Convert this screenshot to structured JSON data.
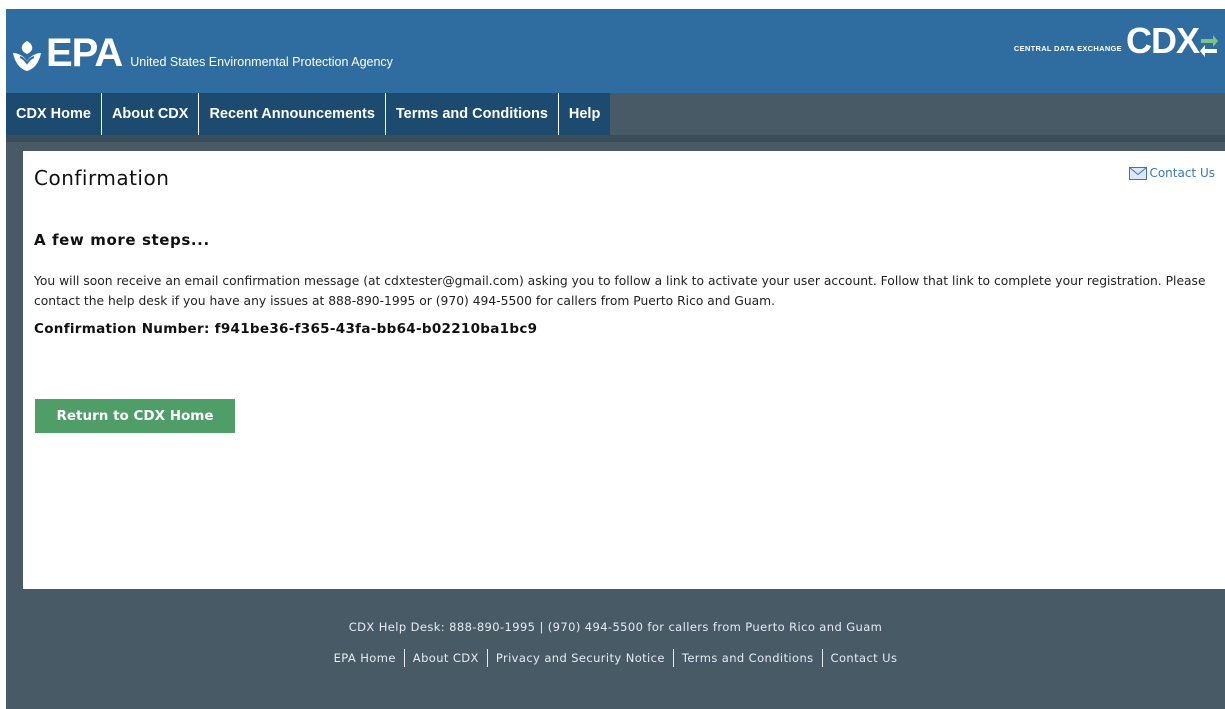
{
  "header": {
    "logo_text": "EPA",
    "agency_name": "United States Environmental Protection Agency",
    "cdx_subtitle": "CENTRAL DATA EXCHANGE",
    "cdx_logo_text": "CDX"
  },
  "nav": {
    "items": [
      {
        "label": "CDX Home"
      },
      {
        "label": "About CDX"
      },
      {
        "label": "Recent Announcements"
      },
      {
        "label": "Terms and Conditions"
      },
      {
        "label": "Help"
      }
    ]
  },
  "main": {
    "title": "Confirmation",
    "contact_label": "Contact Us",
    "subheading": "A few more steps...",
    "message": "You will soon receive an email confirmation message (at cdxtester@gmail.com) asking you to follow a link to activate your user account. Follow that link to complete your registration. Please contact the help desk if you have any issues at 888-890-1995 or (970) 494-5500 for callers from Puerto Rico and Guam.",
    "confirmation_label": "Confirmation Number:",
    "confirmation_number": "f941be36-f365-43fa-bb64-b02210ba1bc9",
    "return_button": "Return to CDX Home"
  },
  "footer": {
    "helpdesk": "CDX Help Desk: 888-890-1995 | (970) 494-5500 for callers from Puerto Rico and Guam",
    "links": [
      "EPA Home",
      "About CDX",
      "Privacy and Security Notice",
      "Terms and Conditions",
      "Contact Us"
    ]
  },
  "colors": {
    "header_blue": "#2f6ca0",
    "nav_dark": "#1d4a6f",
    "page_bg": "#475a66",
    "button_green": "#4f9d67",
    "link_blue": "#3a78b5"
  }
}
